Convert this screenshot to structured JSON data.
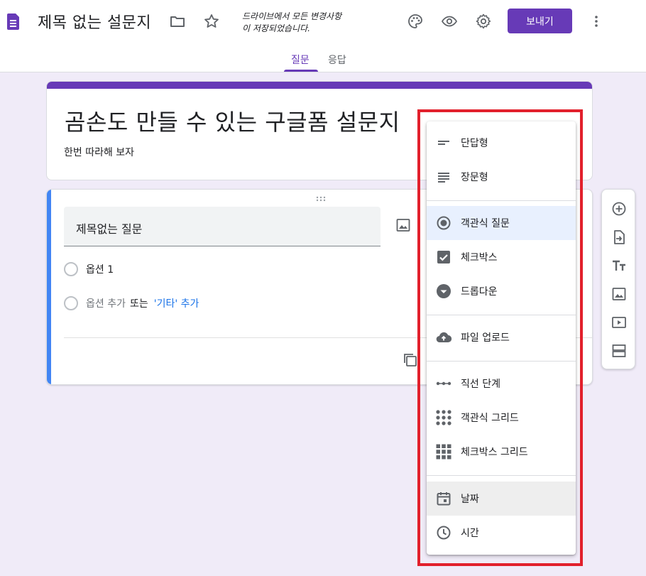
{
  "header": {
    "doc_title": "제목 없는 설문지",
    "save_status_line1": "드라이브에서 모든 변경사항",
    "save_status_line2": "이 저장되었습니다.",
    "send_label": "보내기",
    "tabs": [
      {
        "label": "질문",
        "active": true
      },
      {
        "label": "응답",
        "active": false
      }
    ],
    "icons": [
      "folder-icon",
      "star-icon",
      "palette-icon",
      "preview-eye-icon",
      "settings-gear-icon",
      "more-vert-icon"
    ]
  },
  "form": {
    "title": "곰손도 만들 수 있는 구글폼 설문지",
    "description": "한번 따라해 보자"
  },
  "question": {
    "title_text": "제목없는 질문",
    "options": [
      {
        "label": "옵션 1"
      }
    ],
    "add_option": {
      "label": "옵션 추가",
      "or": "또는",
      "other_link": "'기타' 추가"
    }
  },
  "toolbar": {
    "items": [
      "add-question-icon",
      "import-questions-icon",
      "add-title-text-icon",
      "add-image-icon",
      "add-video-icon",
      "add-section-icon"
    ]
  },
  "type_menu": {
    "groups": [
      [
        {
          "label": "단답형",
          "icon": "short-answer-icon"
        },
        {
          "label": "장문형",
          "icon": "paragraph-icon"
        }
      ],
      [
        {
          "label": "객관식 질문",
          "icon": "radio-icon",
          "selected": true
        },
        {
          "label": "체크박스",
          "icon": "checkbox-icon"
        },
        {
          "label": "드롭다운",
          "icon": "dropdown-icon"
        }
      ],
      [
        {
          "label": "파일 업로드",
          "icon": "cloud-upload-icon"
        }
      ],
      [
        {
          "label": "직선 단계",
          "icon": "linear-scale-icon"
        },
        {
          "label": "객관식 그리드",
          "icon": "radio-grid-icon"
        },
        {
          "label": "체크박스 그리드",
          "icon": "checkbox-grid-icon"
        }
      ],
      [
        {
          "label": "날짜",
          "icon": "calendar-icon",
          "hovered": true
        },
        {
          "label": "시간",
          "icon": "clock-icon"
        }
      ]
    ]
  },
  "colors": {
    "brand": "#673ab7",
    "background": "#f0ebf8",
    "question_accent": "#4285f4",
    "link": "#1a73e8",
    "highlight": "#e2202c",
    "selected_item_bg": "#e8f0fe"
  }
}
